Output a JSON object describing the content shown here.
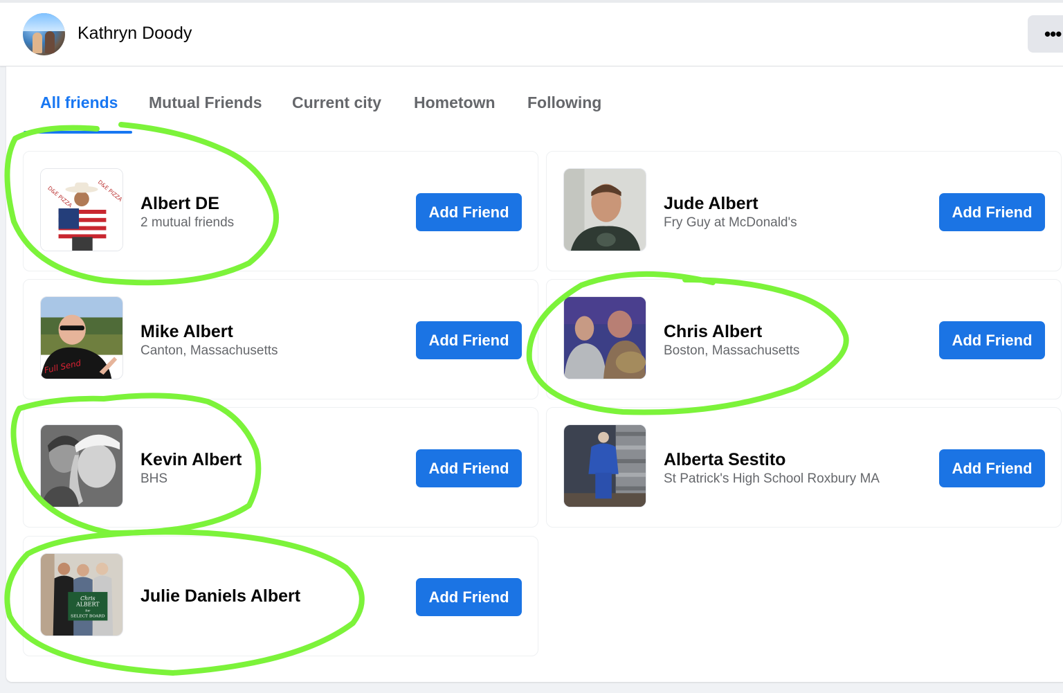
{
  "header": {
    "profile_name": "Kathryn Doody",
    "more_label": "•••"
  },
  "tabs": [
    {
      "label": "All friends",
      "active": true
    },
    {
      "label": "Mutual Friends",
      "active": false
    },
    {
      "label": "Current city",
      "active": false
    },
    {
      "label": "Hometown",
      "active": false
    },
    {
      "label": "Following",
      "active": false
    }
  ],
  "friends": [
    {
      "name": "Albert DE",
      "subtitle": "2 mutual friends",
      "button": "Add Friend",
      "highlighted": true
    },
    {
      "name": "Jude Albert",
      "subtitle": "Fry Guy at McDonald's",
      "button": "Add Friend",
      "highlighted": false
    },
    {
      "name": "Mike Albert",
      "subtitle": "Canton, Massachusetts",
      "button": "Add Friend",
      "highlighted": false
    },
    {
      "name": "Chris Albert",
      "subtitle": "Boston, Massachusetts",
      "button": "Add Friend",
      "highlighted": true
    },
    {
      "name": "Kevin Albert",
      "subtitle": "BHS",
      "button": "Add Friend",
      "highlighted": true
    },
    {
      "name": "Alberta Sestito",
      "subtitle": "St Patrick's High School Roxbury MA",
      "button": "Add Friend",
      "highlighted": false
    },
    {
      "name": "Julie Daniels Albert",
      "subtitle": "",
      "button": "Add Friend",
      "highlighted": true
    }
  ],
  "thumb_text": {
    "albert_de_logo_left": "D&E PIZZA",
    "albert_de_logo_right": "D&E PIZZA",
    "mike_shirt": "Full Send",
    "julie_sign_line1": "Chris",
    "julie_sign_line2": "ALBERT",
    "julie_sign_line3": "for",
    "julie_sign_line4": "SELECT BOARD"
  },
  "colors": {
    "accent": "#1877f2",
    "button": "#1b74e4",
    "annotation": "#7cf33a"
  }
}
